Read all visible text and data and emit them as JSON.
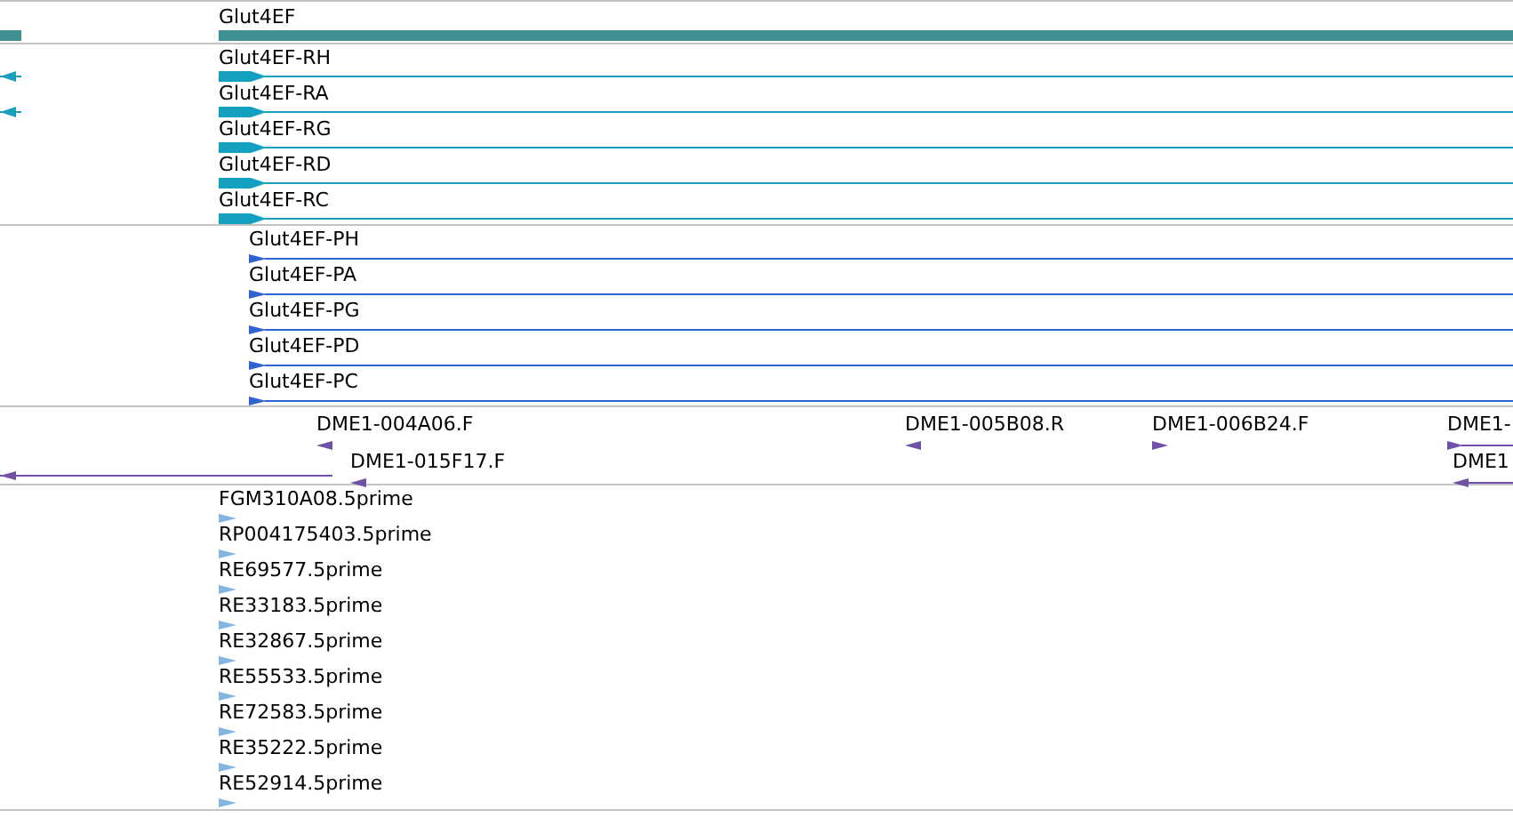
{
  "gene_track": {
    "features": [
      {
        "label": "Glut4EF",
        "upstream_fragment": true
      }
    ]
  },
  "transcript_track": {
    "features": [
      {
        "label": "Glut4EF-RH",
        "upstream_fragment": true
      },
      {
        "label": "Glut4EF-RA",
        "upstream_fragment": true
      },
      {
        "label": "Glut4EF-RG",
        "upstream_fragment": false
      },
      {
        "label": "Glut4EF-RD",
        "upstream_fragment": false
      },
      {
        "label": "Glut4EF-RC",
        "upstream_fragment": false
      }
    ]
  },
  "protein_track": {
    "features": [
      {
        "label": "Glut4EF-PH"
      },
      {
        "label": "Glut4EF-PA"
      },
      {
        "label": "Glut4EF-PG"
      },
      {
        "label": "Glut4EF-PD"
      },
      {
        "label": "Glut4EF-PC"
      }
    ]
  },
  "clone_end_track": {
    "features": [
      {
        "label": "DME1-004A06.F",
        "kind": "reverse"
      },
      {
        "label": "DME1-015F17.F",
        "kind": "reverse"
      },
      {
        "label": "DME1-005B08.R",
        "kind": "reverse"
      },
      {
        "label": "DME1-006B24.F",
        "kind": "forward"
      },
      {
        "label": "DME1-",
        "kind": "forward"
      },
      {
        "label": "DME1",
        "kind": "reverse"
      }
    ]
  },
  "read_track": {
    "features": [
      {
        "label": "FGM310A08.5prime"
      },
      {
        "label": "RP004175403.5prime"
      },
      {
        "label": "RE69577.5prime"
      },
      {
        "label": "RE33183.5prime"
      },
      {
        "label": "RE32867.5prime"
      },
      {
        "label": "RE55533.5prime"
      },
      {
        "label": "RE72583.5prime"
      },
      {
        "label": "RE35222.5prime"
      },
      {
        "label": "RE52914.5prime"
      }
    ]
  }
}
